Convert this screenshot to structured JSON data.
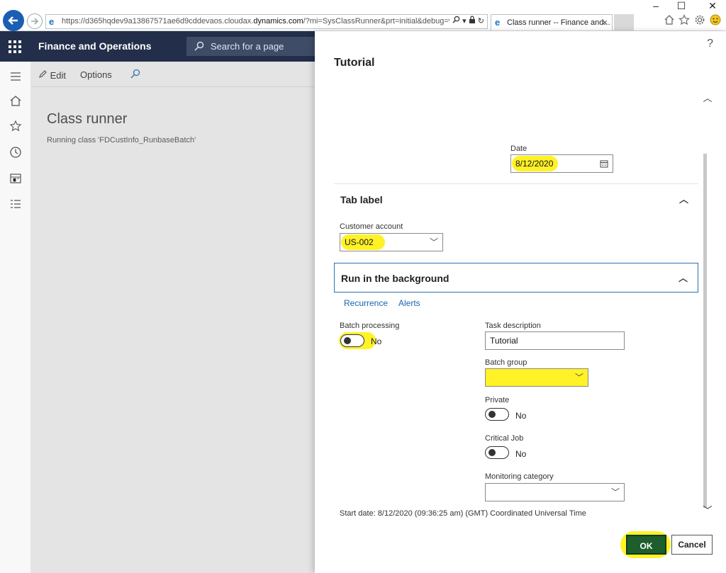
{
  "browser": {
    "url_prefix": "https://d365hqdev9a13867571ae6d9cddevaos.cloudax.",
    "url_host": "dynamics.com",
    "url_suffix": "/?mi=SysClassRunner&prt=initial&debug=vs",
    "tab_title": "Class runner -- Finance and...",
    "tab_close": "×",
    "window_minimize": "–",
    "window_maximize": "☐",
    "window_close": "✕"
  },
  "header": {
    "app_name": "Finance and Operations",
    "search_placeholder": "Search for a page"
  },
  "action_pane": {
    "edit_label": "Edit",
    "options_label": "Options"
  },
  "page": {
    "title": "Class runner",
    "subtitle": "Running class 'FDCustInfo_RunbaseBatch'"
  },
  "dialog": {
    "help": "?",
    "title": "Tutorial",
    "date_label": "Date",
    "date_value": "8/12/2020",
    "tab_label_section": "Tab label",
    "customer_account_label": "Customer account",
    "customer_account_value": "US-002",
    "run_background_section": "Run in the background",
    "recurrence_link": "Recurrence",
    "alerts_link": "Alerts",
    "batch_processing_label": "Batch processing",
    "batch_processing_value": "No",
    "task_description_label": "Task description",
    "task_description_value": "Tutorial",
    "batch_group_label": "Batch group",
    "batch_group_value": "",
    "private_label": "Private",
    "private_value": "No",
    "critical_job_label": "Critical Job",
    "critical_job_value": "No",
    "monitoring_category_label": "Monitoring category",
    "monitoring_category_value": "",
    "start_date_text": "Start date: 8/12/2020 (09:36:25 am) (GMT) Coordinated Universal Time",
    "ok_label": "OK",
    "cancel_label": "Cancel"
  },
  "colors": {
    "header_bg": "#232f4a",
    "highlight": "#fff227",
    "ok_button": "#1d5e2c",
    "link": "#1b64b0"
  }
}
